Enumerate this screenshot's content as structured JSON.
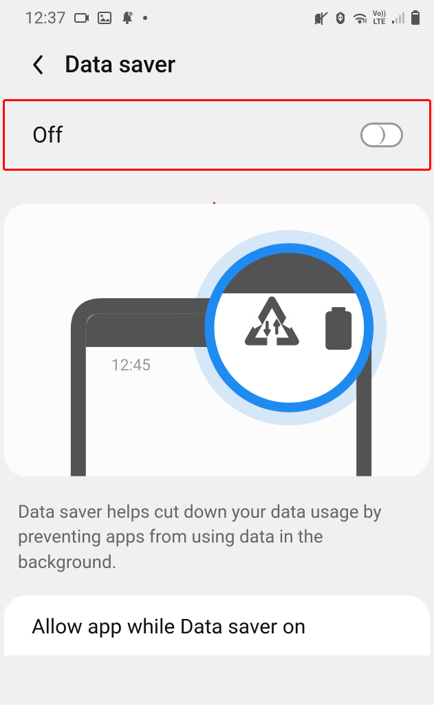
{
  "status": {
    "time": "12:37"
  },
  "header": {
    "title": "Data saver"
  },
  "toggle": {
    "label": "Off",
    "value": false
  },
  "illustration": {
    "mini_time": "12:45"
  },
  "description": "Data saver helps cut down your data usage by preventing apps from using data in the background.",
  "allow": {
    "label": "Allow app while Data saver on"
  }
}
